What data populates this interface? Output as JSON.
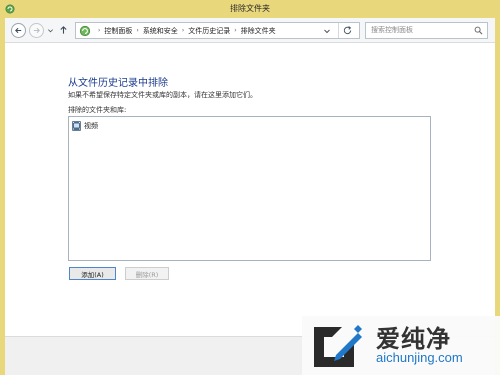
{
  "window": {
    "title": "排除文件夹"
  },
  "address_bar": {
    "crumbs": [
      "控制面板",
      "系统和安全",
      "文件历史记录",
      "排除文件夹"
    ]
  },
  "search": {
    "placeholder": "搜索控制面板"
  },
  "content": {
    "heading": "从文件历史记录中排除",
    "description": "如果不希望保存特定文件夹或库的副本，请在这里添加它们。",
    "list_label": "排除的文件夹和库:",
    "items": [
      {
        "label": "视频",
        "icon": "video-library-icon"
      }
    ],
    "add_button": "添加(A)",
    "remove_button": "删除(R)"
  },
  "watermark": {
    "brand": "爱纯净",
    "url": "aichunjing.com"
  },
  "colors": {
    "title_bar": "#e8d77b",
    "heading": "#1c3c8f",
    "watermark_url": "#2178c8"
  }
}
